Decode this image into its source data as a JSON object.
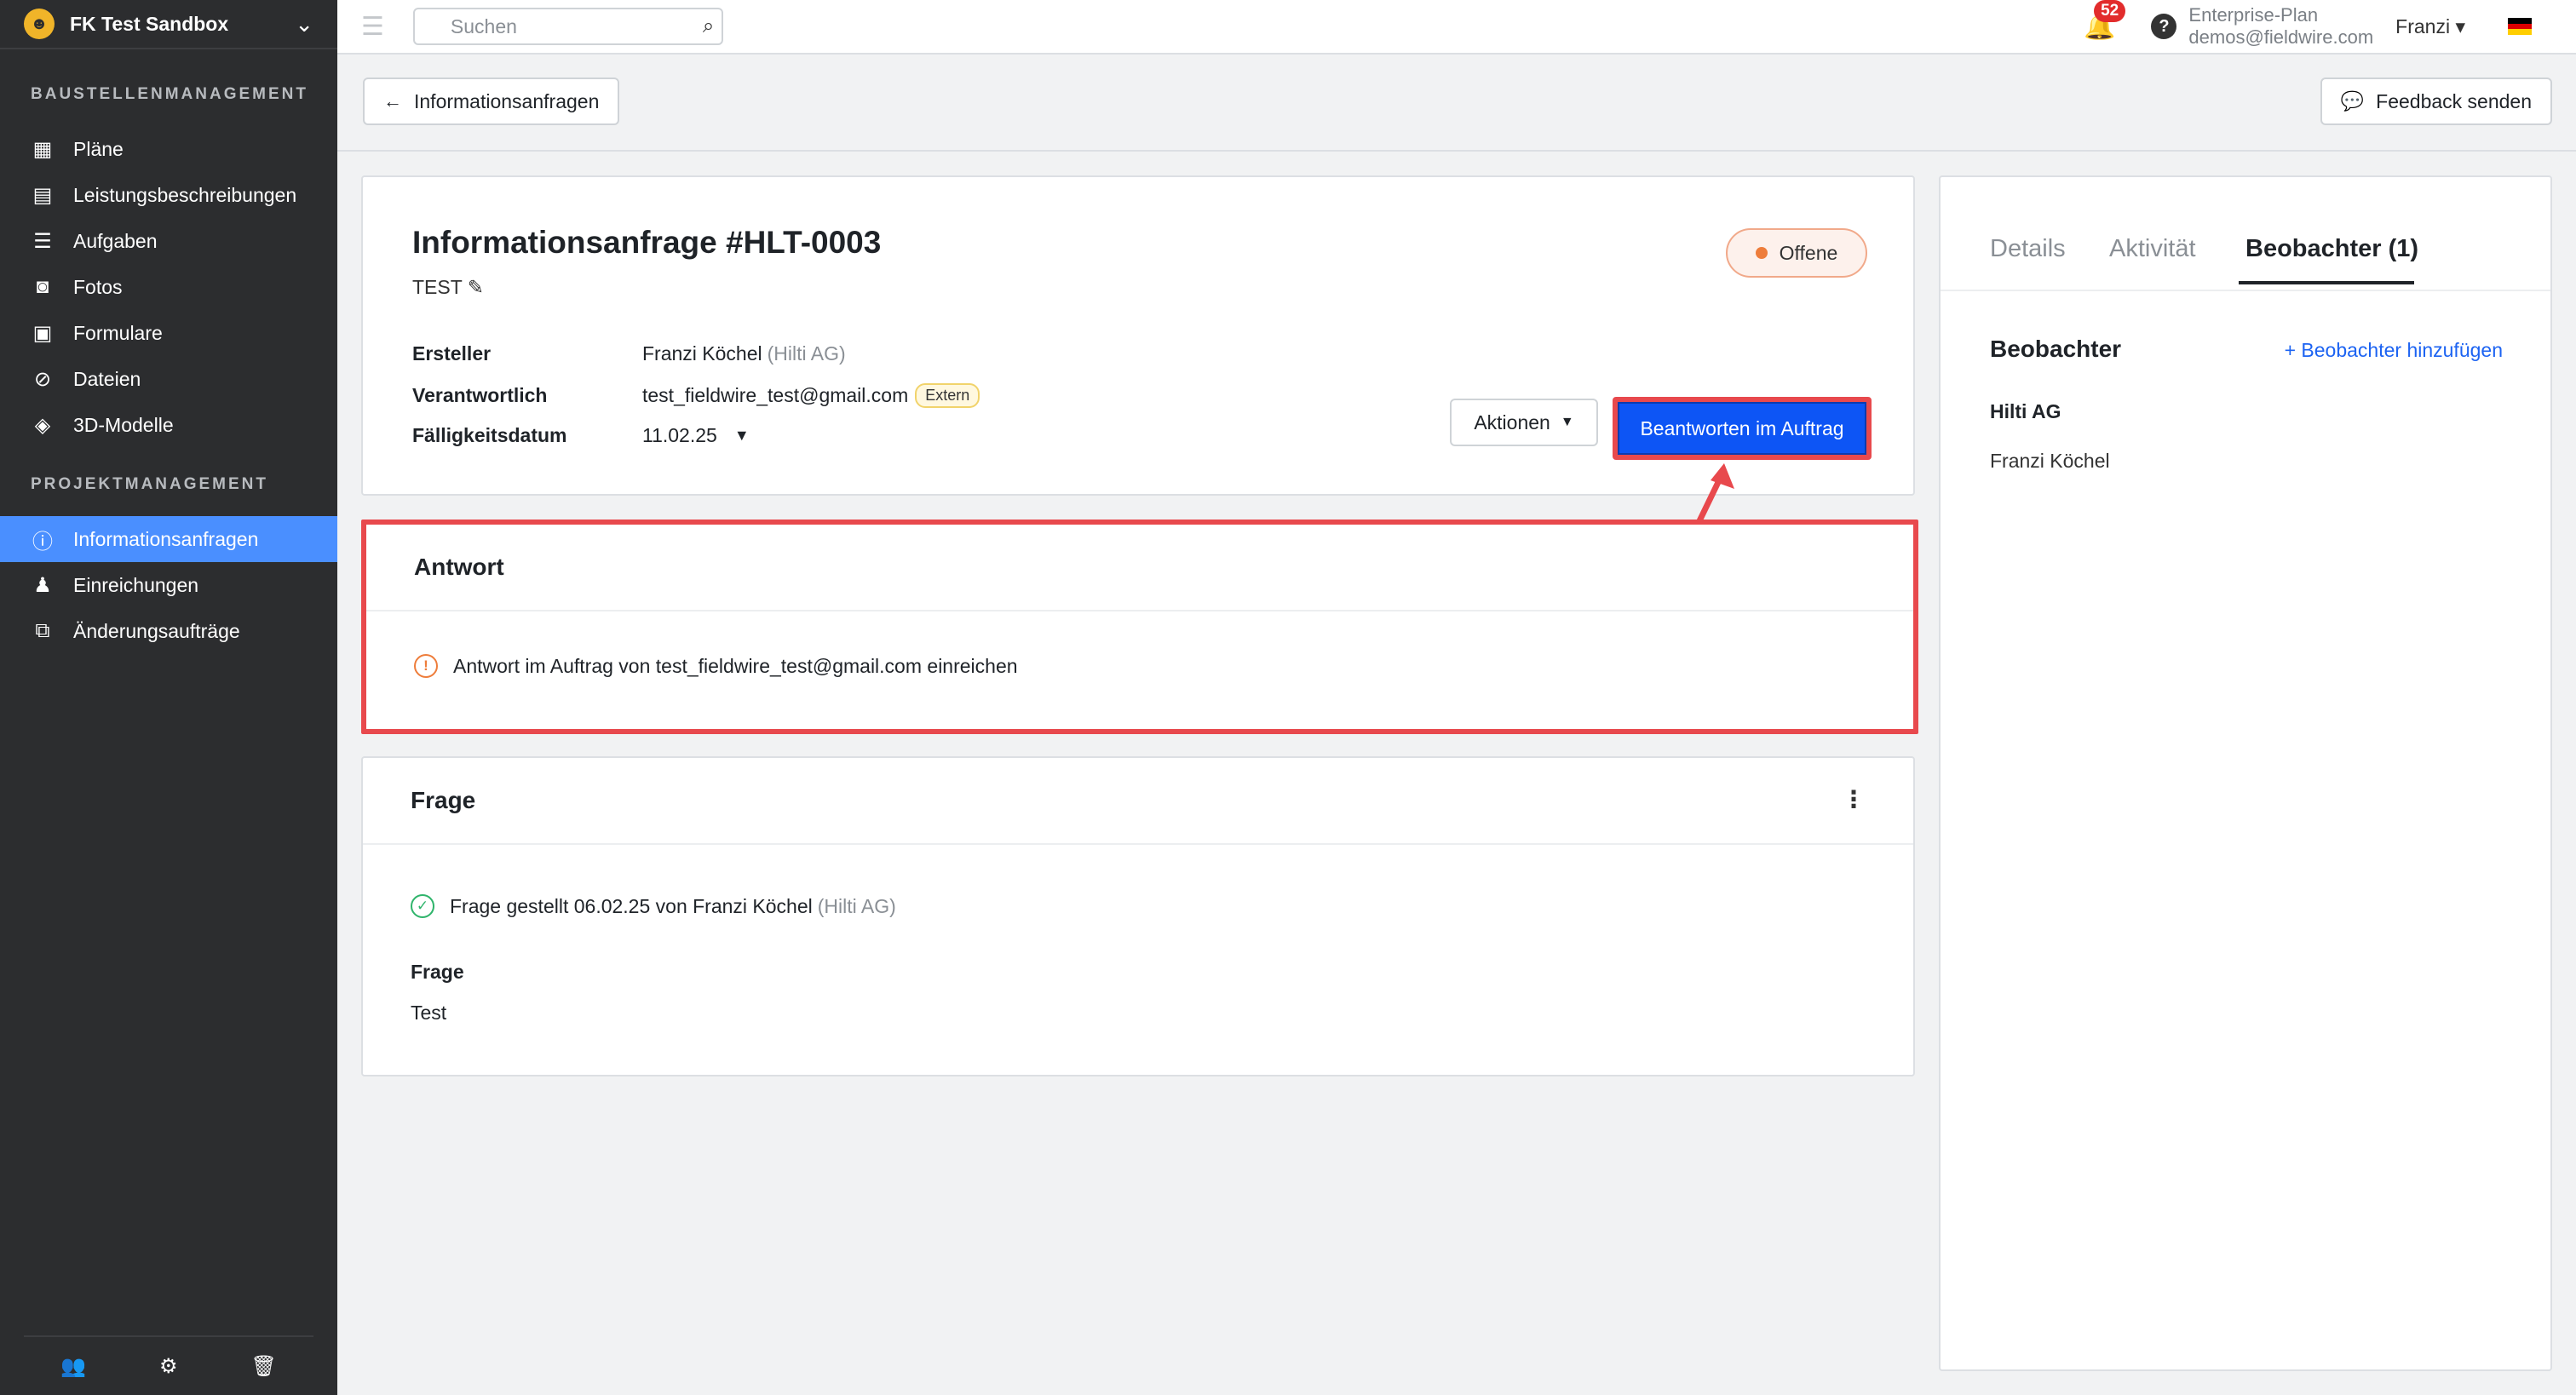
{
  "sidebar": {
    "project_name": "FK Test Sandbox",
    "sections": [
      {
        "title": "BAUSTELLENMANAGEMENT",
        "items": [
          {
            "label": "Pläne",
            "icon": "plans-icon"
          },
          {
            "label": "Leistungsbeschreibungen",
            "icon": "specs-icon"
          },
          {
            "label": "Aufgaben",
            "icon": "tasks-icon"
          },
          {
            "label": "Fotos",
            "icon": "camera-icon"
          },
          {
            "label": "Formulare",
            "icon": "forms-icon"
          },
          {
            "label": "Dateien",
            "icon": "paperclip-icon"
          },
          {
            "label": "3D-Modelle",
            "icon": "cube-icon"
          }
        ]
      },
      {
        "title": "PROJEKTMANAGEMENT",
        "items": [
          {
            "label": "Informationsanfragen",
            "icon": "rfi-icon",
            "active": true
          },
          {
            "label": "Einreichungen",
            "icon": "submittal-icon"
          },
          {
            "label": "Änderungsaufträge",
            "icon": "change-order-icon"
          }
        ]
      }
    ],
    "footer_icons": [
      "people-icon",
      "gear-icon",
      "trash-icon"
    ]
  },
  "topbar": {
    "search_placeholder": "Suchen",
    "notifications_count": "52",
    "plan_name": "Enterprise-Plan",
    "account_email": "demos@fieldwire.com",
    "user_name": "Franzi",
    "language_flag": "de"
  },
  "subheader": {
    "back_label": "Informationsanfragen",
    "feedback_label": "Feedback senden"
  },
  "rfi": {
    "title": "Informationsanfrage #HLT-0003",
    "subtitle": "TEST",
    "status": "Offene",
    "creator_label": "Ersteller",
    "creator_name": "Franzi Köchel",
    "creator_company": "(Hilti AG)",
    "responsible_label": "Verantwortlich",
    "responsible_email": "test_fieldwire_test@gmail.com",
    "responsible_badge": "Extern",
    "due_label": "Fälligkeitsdatum",
    "due_date": "11.02.25",
    "actions_label": "Aktionen",
    "answer_on_behalf_label": "Beantworten im Auftrag"
  },
  "answer_card": {
    "heading": "Antwort",
    "message": "Antwort im Auftrag von test_fieldwire_test@gmail.com einreichen"
  },
  "question_card": {
    "heading": "Frage",
    "asked_prefix": "Frage gestellt 06.02.25 von Franzi Köchel",
    "asked_company": "(Hilti AG)",
    "field_label": "Frage",
    "field_value": "Test"
  },
  "right_panel": {
    "tabs": [
      "Details",
      "Aktivität",
      "Beobachter (1)"
    ],
    "active_tab": 2,
    "observers_heading": "Beobachter",
    "add_observer_label": "+ Beobachter hinzufügen",
    "observer_company": "Hilti AG",
    "observer_person": "Franzi Köchel"
  },
  "colors": {
    "sidebar_bg": "#2c2d2f",
    "active_nav": "#4a8fff",
    "primary_button": "#0d55f5",
    "status_dot": "#ee7d3b",
    "annotation_red": "#e8494d",
    "link_blue": "#1c63f2"
  }
}
